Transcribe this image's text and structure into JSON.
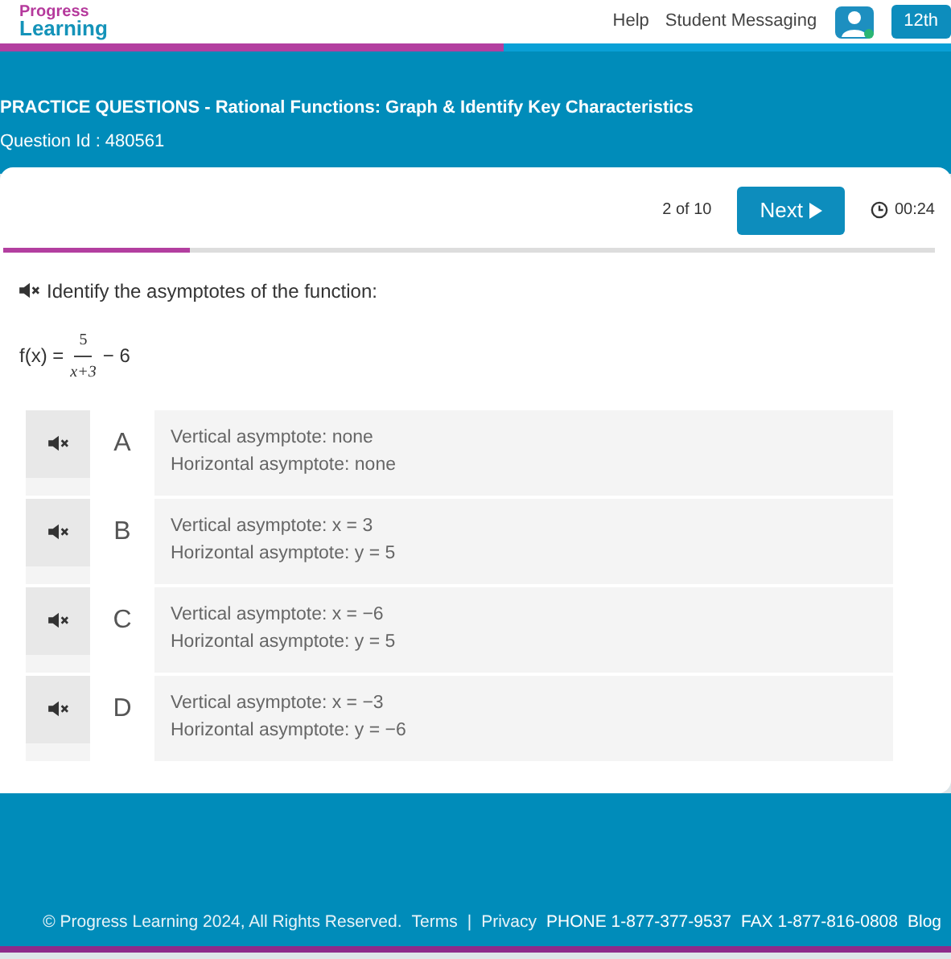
{
  "header": {
    "logo": [
      "Progress",
      "Learning"
    ],
    "help": "Help",
    "messaging": "Student Messaging",
    "grade": "12th"
  },
  "banner": {
    "title": "PRACTICE QUESTIONS - Rational Functions: Graph & Identify Key Characteristics",
    "question_id": "Question Id : 480561"
  },
  "quiz": {
    "position": "2 of 10",
    "next": "Next",
    "timer": "00:24",
    "level": 0.2,
    "prompt": "Identify the asymptotes of the function:",
    "function": {
      "lhs": "f(x) =",
      "numerator": "5",
      "denominator": "x+3",
      "rest": "− 6"
    },
    "options": [
      {
        "letter": "A",
        "lines": [
          "Vertical asymptote: none",
          "Horizontal asymptote: none"
        ]
      },
      {
        "letter": "B",
        "lines": [
          "Vertical asymptote: x = 3",
          "Horizontal asymptote: y = 5"
        ]
      },
      {
        "letter": "C",
        "lines": [
          "Vertical asymptote: x = −6",
          "Horizontal asymptote: y = 5"
        ]
      },
      {
        "letter": "D",
        "lines": [
          "Vertical asymptote: x = −3",
          "Horizontal asymptote: y = −6"
        ]
      }
    ]
  },
  "footer": {
    "copyright": "© Progress Learning 2024, All Rights Reserved.",
    "links": [
      "Terms",
      "Privacy"
    ],
    "separator": "|",
    "phone": "PHONE 1-877-377-9537",
    "fax": "FAX 1-877-816-0808",
    "blog": "Blog"
  }
}
